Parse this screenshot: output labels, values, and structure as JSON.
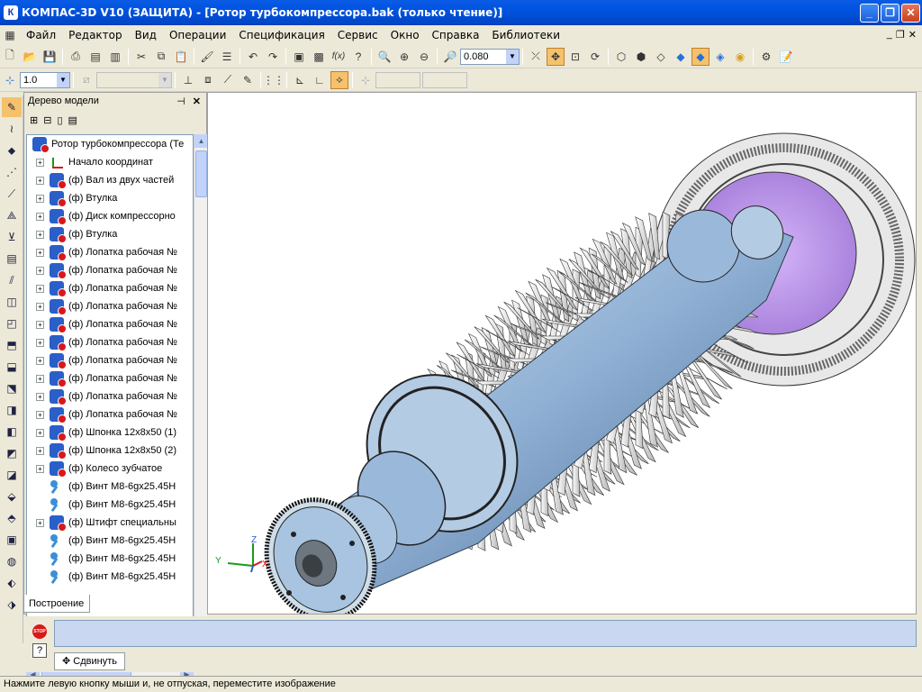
{
  "window": {
    "title": "КОМПАС-3D V10 (ЗАЩИТА) - [Ротор турбокомпрессора.bak (только чтение)]",
    "app_icon": "К"
  },
  "menu": [
    "Файл",
    "Редактор",
    "Вид",
    "Операции",
    "Спецификация",
    "Сервис",
    "Окно",
    "Справка",
    "Библиотеки"
  ],
  "toolbar1": {
    "zoom_value": "0.080"
  },
  "toolbar2": {
    "step_value": "1.0"
  },
  "tree_panel": {
    "title": "Дерево модели",
    "pin": "ф",
    "close": "✕",
    "items": [
      {
        "label": "Ротор турбокомпрессора (Те",
        "icon": "assembly",
        "expander": ""
      },
      {
        "label": "Начало координат",
        "icon": "origin",
        "expander": "+"
      },
      {
        "label": "(ф) Вал из двух частей",
        "icon": "part",
        "expander": "+"
      },
      {
        "label": "(ф) Втулка",
        "icon": "part",
        "expander": "+"
      },
      {
        "label": "(ф) Диск компрессорно",
        "icon": "part",
        "expander": "+"
      },
      {
        "label": "(ф) Втулка",
        "icon": "part",
        "expander": "+"
      },
      {
        "label": "(ф) Лопатка рабочая №",
        "icon": "part",
        "expander": "+"
      },
      {
        "label": "(ф) Лопатка рабочая №",
        "icon": "part",
        "expander": "+"
      },
      {
        "label": "(ф) Лопатка рабочая №",
        "icon": "part",
        "expander": "+"
      },
      {
        "label": "(ф) Лопатка рабочая №",
        "icon": "part",
        "expander": "+"
      },
      {
        "label": "(ф) Лопатка рабочая №",
        "icon": "part",
        "expander": "+"
      },
      {
        "label": "(ф) Лопатка рабочая №",
        "icon": "part",
        "expander": "+"
      },
      {
        "label": "(ф) Лопатка рабочая №",
        "icon": "part",
        "expander": "+"
      },
      {
        "label": "(ф) Лопатка рабочая №",
        "icon": "part",
        "expander": "+"
      },
      {
        "label": "(ф) Лопатка рабочая №",
        "icon": "part",
        "expander": "+"
      },
      {
        "label": "(ф) Лопатка рабочая №",
        "icon": "part",
        "expander": "+"
      },
      {
        "label": "(ф) Шпонка 12x8x50 (1)",
        "icon": "part",
        "expander": "+"
      },
      {
        "label": "(ф) Шпонка 12x8x50 (2)",
        "icon": "part",
        "expander": "+"
      },
      {
        "label": "(ф) Колесо зубчатое",
        "icon": "part",
        "expander": "+"
      },
      {
        "label": "(ф) Винт M8-6gx25.45H",
        "icon": "screw",
        "expander": ""
      },
      {
        "label": "(ф) Винт M8-6gx25.45H",
        "icon": "screw",
        "expander": ""
      },
      {
        "label": "(ф) Штифт специальны",
        "icon": "part",
        "expander": "+"
      },
      {
        "label": "(ф) Винт M8-6gx25.45H",
        "icon": "screw",
        "expander": ""
      },
      {
        "label": "(ф) Винт M8-6gx25.45H",
        "icon": "screw",
        "expander": ""
      },
      {
        "label": "(ф) Винт M8-6gx25.45H",
        "icon": "screw",
        "expander": ""
      }
    ]
  },
  "tabs": {
    "build": "Построение"
  },
  "axes": {
    "x": "X",
    "y": "Y",
    "z": "Z"
  },
  "bottom": {
    "stop": "STOP",
    "help": "?",
    "move_button": "Сдвинуть"
  },
  "status": "Нажмите левую кнопку мыши и, не отпуская, переместите изображение",
  "colors": {
    "title_blue": "#0053e0",
    "shaft_blue": "#a8c4e0",
    "disk_purple": "#c49af0",
    "blade_white": "#f0f0f0"
  }
}
